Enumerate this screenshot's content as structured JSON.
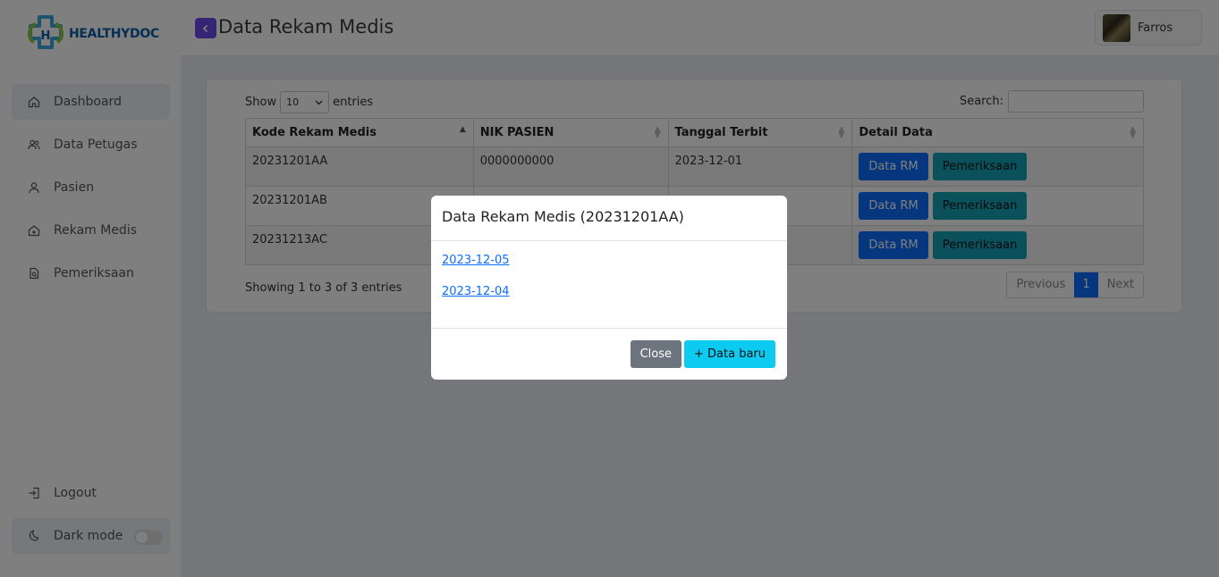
{
  "brand": {
    "name": "HEALTHYDOC"
  },
  "sidebar": {
    "items": [
      {
        "label": "Dashboard",
        "icon": "home-icon"
      },
      {
        "label": "Data Petugas",
        "icon": "users-icon"
      },
      {
        "label": "Pasien",
        "icon": "user-icon"
      },
      {
        "label": "Rekam Medis",
        "icon": "house-medical-icon"
      },
      {
        "label": "Pemeriksaan",
        "icon": "file-search-icon"
      }
    ],
    "logout_label": "Logout",
    "dark_mode_label": "Dark mode",
    "dark_mode_on": false
  },
  "header": {
    "title": "Data Rekam Medis",
    "user_name": "Farros"
  },
  "table_controls": {
    "show_label": "Show",
    "entries_value": "10",
    "entries_label": "entries",
    "search_label": "Search:",
    "search_value": ""
  },
  "table": {
    "columns": [
      "Kode Rekam Medis",
      "NIK PASIEN",
      "Tanggal Terbit",
      "Detail Data"
    ],
    "rows": [
      {
        "kode": "20231201AA",
        "nik": "0000000000",
        "tanggal": "2023-12-01"
      },
      {
        "kode": "20231201AB",
        "nik": "",
        "tanggal": ""
      },
      {
        "kode": "20231213AC",
        "nik": "",
        "tanggal": ""
      }
    ],
    "btn_rm_label": "Data RM",
    "btn_pem_label": "Pemeriksaan"
  },
  "footer_info": "Showing 1 to 3 of 3 entries",
  "pagination": {
    "previous": "Previous",
    "current": "1",
    "next": "Next"
  },
  "modal": {
    "title": "Data Rekam Medis (20231201AA)",
    "links": [
      "2023-12-05",
      "2023-12-04"
    ],
    "close_label": "Close",
    "new_label": "+ Data baru"
  },
  "colors": {
    "primary": "#0d6efd",
    "info": "#17a2b8",
    "cyan": "#0dcaf0",
    "secondary": "#6c757d",
    "accent": "#6d4ae8"
  }
}
